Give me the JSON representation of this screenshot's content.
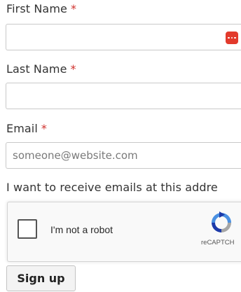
{
  "form": {
    "first_name": {
      "label": "First Name",
      "required_marker": "*",
      "value": "",
      "placeholder": ""
    },
    "last_name": {
      "label": "Last Name",
      "required_marker": "*",
      "value": "",
      "placeholder": ""
    },
    "email": {
      "label": "Email",
      "required_marker": "*",
      "value": "",
      "placeholder": "someone@website.com"
    },
    "consent_text": "I want to receive emails at this addre",
    "captcha": {
      "checkbox_label": "I'm not a robot",
      "brand_text": "reCAPTCH",
      "checked": false
    },
    "submit_label": "Sign up"
  },
  "colors": {
    "required": "#d0312d",
    "password_manager_icon": "#e23a2c",
    "recaptcha_blue": "#4a90e2",
    "recaptcha_gray": "#a6a6a6"
  },
  "icons": {
    "password_manager": "password-manager-icon",
    "recaptcha": "recaptcha-logo-icon"
  }
}
